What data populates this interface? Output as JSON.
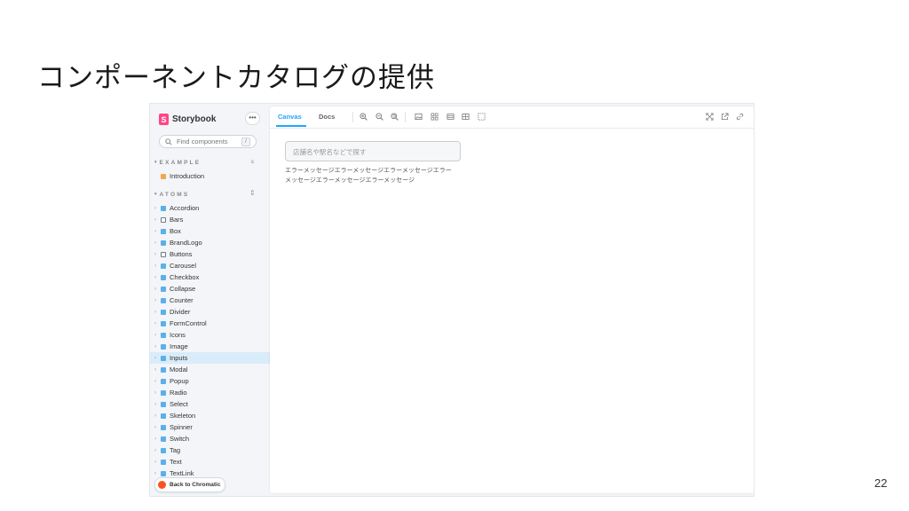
{
  "slide": {
    "title": "コンポーネントカタログの提供",
    "page_number": "22"
  },
  "storybook": {
    "brand": "Storybook",
    "menu_label": "•••",
    "search": {
      "placeholder": "Find components",
      "shortcut": "/"
    },
    "groups": [
      {
        "label": "EXAMPLE",
        "control": "⌅"
      },
      {
        "label": "ATOMS",
        "control": "⇕"
      }
    ],
    "example_items": [
      {
        "label": "Introduction",
        "kind": "doc"
      }
    ],
    "atoms_items": [
      {
        "label": "Accordion",
        "kind": "comp"
      },
      {
        "label": "Bars",
        "kind": "folder"
      },
      {
        "label": "Box",
        "kind": "comp"
      },
      {
        "label": "BrandLogo",
        "kind": "comp"
      },
      {
        "label": "Buttons",
        "kind": "folder"
      },
      {
        "label": "Carousel",
        "kind": "comp"
      },
      {
        "label": "Checkbox",
        "kind": "comp"
      },
      {
        "label": "Collapse",
        "kind": "comp"
      },
      {
        "label": "Counter",
        "kind": "comp"
      },
      {
        "label": "Divider",
        "kind": "comp"
      },
      {
        "label": "FormControl",
        "kind": "comp"
      },
      {
        "label": "Icons",
        "kind": "comp"
      },
      {
        "label": "Image",
        "kind": "comp"
      },
      {
        "label": "Inputs",
        "kind": "comp",
        "selected": true
      },
      {
        "label": "Modal",
        "kind": "comp"
      },
      {
        "label": "Popup",
        "kind": "comp"
      },
      {
        "label": "Radio",
        "kind": "comp"
      },
      {
        "label": "Select",
        "kind": "comp"
      },
      {
        "label": "Skeleton",
        "kind": "comp"
      },
      {
        "label": "Spinner",
        "kind": "comp"
      },
      {
        "label": "Switch",
        "kind": "comp"
      },
      {
        "label": "Tag",
        "kind": "comp"
      },
      {
        "label": "Text",
        "kind": "comp"
      },
      {
        "label": "TextLink",
        "kind": "comp"
      }
    ],
    "chromatic_label": "Back to Chromatic",
    "tabs": [
      {
        "label": "Canvas",
        "active": true
      },
      {
        "label": "Docs",
        "active": false
      }
    ],
    "toolbar_icons": [
      "zoom-in-icon",
      "zoom-out-icon",
      "zoom-reset-icon",
      "background-icon",
      "grid-icon",
      "viewport-icon",
      "measure-icon",
      "outline-icon",
      "fullscreen-icon",
      "open-new-tab-icon",
      "copy-link-icon"
    ],
    "preview": {
      "input_placeholder": "店舗名や駅名などで探す",
      "error_line1": "エラーメッセージエラーメッセージエラーメッセージエラー",
      "error_line2": "メッセージエラーメッセージエラーメッセージ"
    },
    "colors": {
      "accent": "#1ea7fd",
      "brand": "#ff4785",
      "selected_row": "#d9ecfa",
      "chromatic": "#fc521f"
    }
  }
}
